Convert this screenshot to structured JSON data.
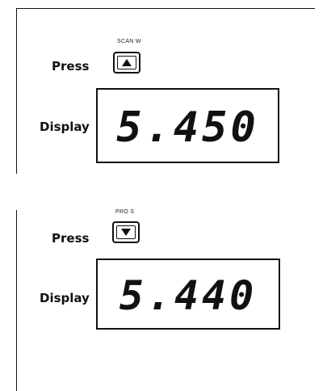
{
  "steps": [
    {
      "key_caption": "SCAN W",
      "press_label": "Press",
      "key_icon": "up-triangle-icon",
      "display_label": "Display",
      "display_value": "5.450"
    },
    {
      "key_caption": "PRO S",
      "press_label": "Press",
      "key_icon": "down-triangle-icon",
      "display_label": "Display",
      "display_value": "5.440"
    }
  ]
}
